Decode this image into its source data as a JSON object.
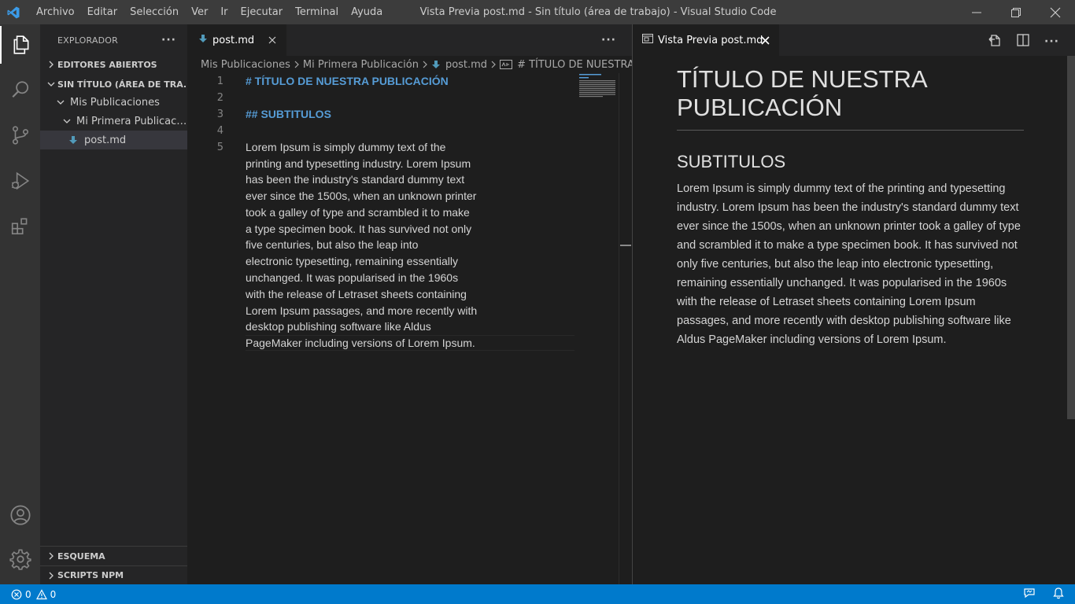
{
  "titlebar": {
    "menu": [
      "Archivo",
      "Editar",
      "Selección",
      "Ver",
      "Ir",
      "Ejecutar",
      "Terminal",
      "Ayuda"
    ],
    "window_title": "Vista Previa post.md - Sin título (área de trabajo) - Visual Studio Code"
  },
  "activitybar": {
    "icons": [
      "explorer-icon",
      "search-icon",
      "source-control-icon",
      "run-debug-icon",
      "extensions-icon",
      "account-icon",
      "settings-gear-icon"
    ]
  },
  "sidebar": {
    "title": "EXPLORADOR",
    "more": "···",
    "open_editors": "EDITORES ABIERTOS",
    "workspace": "SIN TÍTULO (ÁREA DE TRA...",
    "folder1": "Mis Publicaciones",
    "folder2": "Mi Primera Publicaci...",
    "file": "post.md",
    "outline": "ESQUEMA",
    "npm_scripts": "SCRIPTS NPM"
  },
  "editor": {
    "tab_label": "post.md",
    "more": "···",
    "breadcrumb": [
      "Mis Publicaciones",
      "Mi Primera Publicación",
      "post.md",
      "# TÍTULO DE NUESTRA"
    ],
    "line_numbers": [
      "1",
      "2",
      "3",
      "4",
      "5"
    ],
    "line1": "# TÍTULO DE NUESTRA PUBLICACIÓN",
    "line3": "## SUBTITULOS",
    "line5_wrapped": [
      "Lorem Ipsum is simply dummy text of the",
      "printing and typesetting industry. Lorem Ipsum",
      "has been the industry's standard dummy text",
      "ever since the 1500s, when an unknown printer",
      "took a galley of type and scrambled it to make",
      "a type specimen book. It has survived not only",
      "five centuries, but also the leap into",
      "electronic typesetting, remaining essentially",
      "unchanged. It was popularised in the 1960s",
      "with the release of Letraset sheets containing",
      "Lorem Ipsum passages, and more recently with",
      "desktop publishing software like Aldus",
      "PageMaker including versions of Lorem Ipsum."
    ]
  },
  "preview": {
    "tab_label": "Vista Previa post.md",
    "more": "···",
    "h1": "TÍTULO DE NUESTRA PUBLICACIÓN",
    "h2": "SUBTITULOS",
    "paragraph": "Lorem Ipsum is simply dummy text of the printing and typesetting industry. Lorem Ipsum has been the industry's standard dummy text ever since the 1500s, when an unknown printer took a galley of type and scrambled it to make a type specimen book. It has survived not only five centuries, but also the leap into electronic typesetting, remaining essentially unchanged. It was popularised in the 1960s with the release of Letraset sheets containing Lorem Ipsum passages, and more recently with desktop publishing software like Aldus PageMaker including versions of Lorem Ipsum."
  },
  "statusbar": {
    "errors": "0",
    "warnings": "0"
  },
  "colors": {
    "accent": "#007acc",
    "heading": "#569cd6",
    "markdown_icon": "#519aba"
  }
}
